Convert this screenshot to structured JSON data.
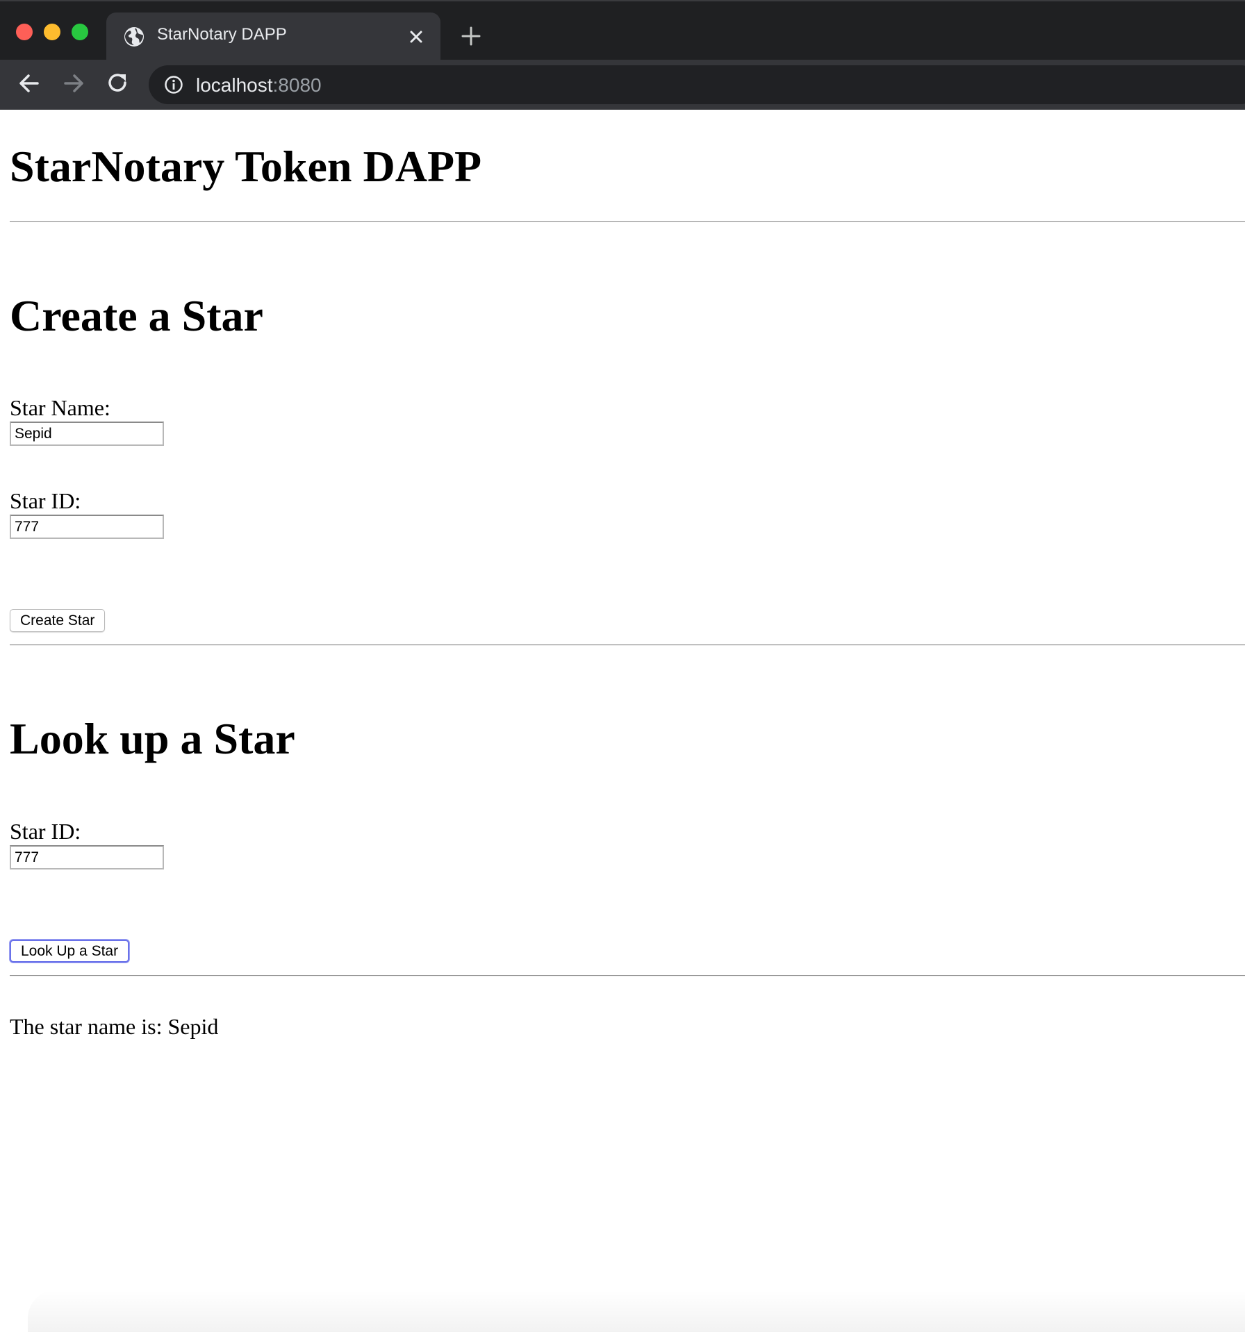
{
  "browser": {
    "tab_title": "StarNotary DAPP",
    "url_host": "localhost",
    "url_port": ":8080",
    "icons": {
      "favicon": "globe-icon",
      "close_tab": "close-icon",
      "new_tab": "plus-icon",
      "back": "arrow-left-icon",
      "forward": "arrow-right-icon",
      "reload": "reload-icon",
      "site_info": "info-icon"
    },
    "colors": {
      "traffic_close": "#fe5f57",
      "traffic_minimize": "#febc2e",
      "traffic_maximize": "#28c840",
      "focus_ring": "#6a72ea"
    }
  },
  "page": {
    "title": "StarNotary Token DAPP",
    "create_section": {
      "heading": "Create a Star",
      "star_name_label": "Star Name:",
      "star_name_value": "Sepid",
      "star_id_label": "Star ID:",
      "star_id_value": "777",
      "button_label": "Create Star"
    },
    "lookup_section": {
      "heading": "Look up a Star",
      "star_id_label": "Star ID:",
      "star_id_value": "777",
      "button_label": "Look Up a Star"
    },
    "result_text": "The star name is: Sepid"
  }
}
